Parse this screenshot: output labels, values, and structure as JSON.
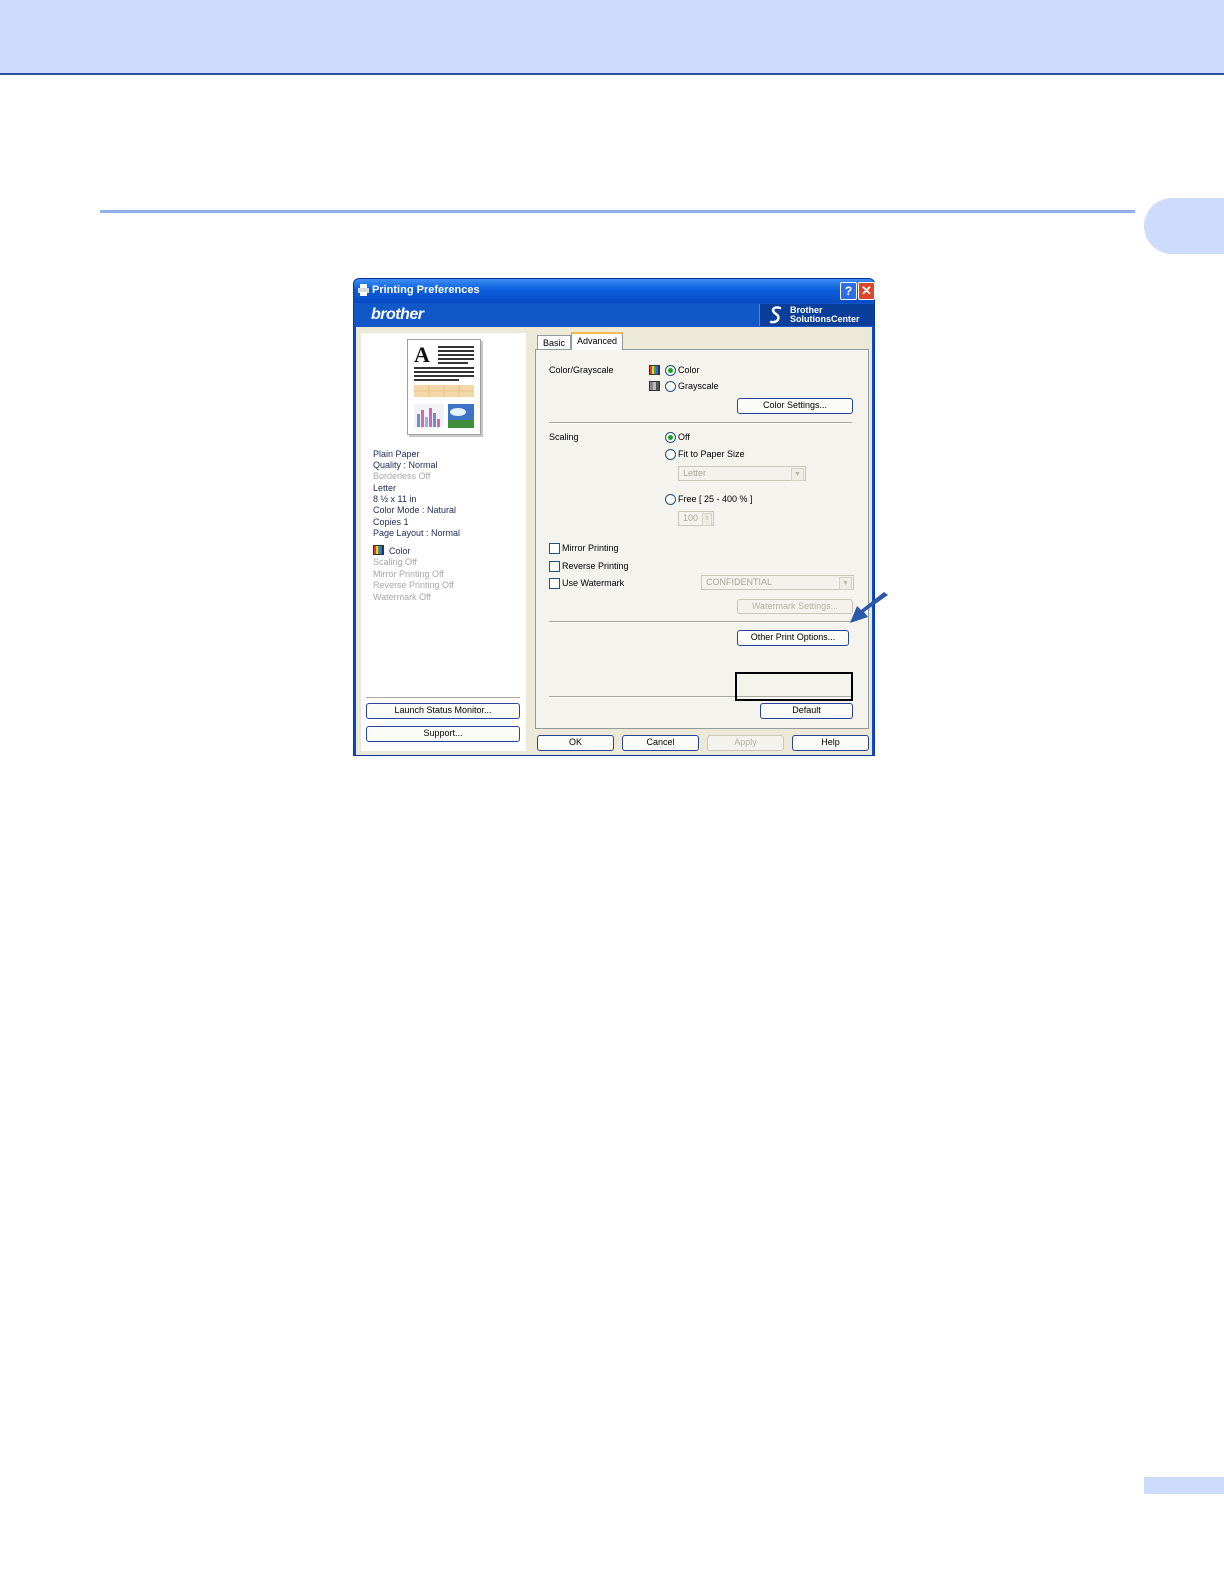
{
  "dialog": {
    "title": "Printing Preferences",
    "brand": "brother",
    "solutions_center": [
      "Brother",
      "SolutionsCenter"
    ],
    "help_glyph": "?",
    "close_glyph": "✕"
  },
  "left_panel": {
    "info_lines": [
      "Plain Paper",
      "Quality : Normal"
    ],
    "borderless": "Borderless Off",
    "info_lines2": [
      "Letter",
      "8 ½ x 11 in",
      "Color Mode : Natural",
      "Copies 1",
      "Page Layout : Normal"
    ],
    "color_label": "Color",
    "gray_lines": [
      "Scaling Off",
      "Mirror Printing Off",
      "Reverse Printing Off",
      "Watermark Off"
    ],
    "launch_button": "Launch Status Monitor...",
    "support_button": "Support..."
  },
  "tabs": [
    "Basic",
    "Advanced"
  ],
  "advanced": {
    "color_grayscale_label": "Color/Grayscale",
    "color_option": "Color",
    "grayscale_option": "Grayscale",
    "color_settings_button": "Color Settings...",
    "scaling_label": "Scaling",
    "scaling_off": "Off",
    "fit_to_paper": "Fit to Paper Size",
    "paper_size_value": "Letter",
    "free_option": "Free [ 25 - 400 % ]",
    "free_value": "100",
    "mirror_printing": "Mirror Printing",
    "reverse_printing": "Reverse Printing",
    "use_watermark": "Use Watermark",
    "watermark_value": "CONFIDENTIAL",
    "watermark_settings_button": "Watermark Settings...",
    "other_print_options_button": "Other Print Options...",
    "default_button": "Default"
  },
  "footer": {
    "ok": "OK",
    "cancel": "Cancel",
    "apply": "Apply",
    "help": "Help"
  },
  "colors": {
    "page_band": "#cddcfc",
    "title_bar": "#0b5fdc",
    "arrow": "#2b5aa8"
  }
}
